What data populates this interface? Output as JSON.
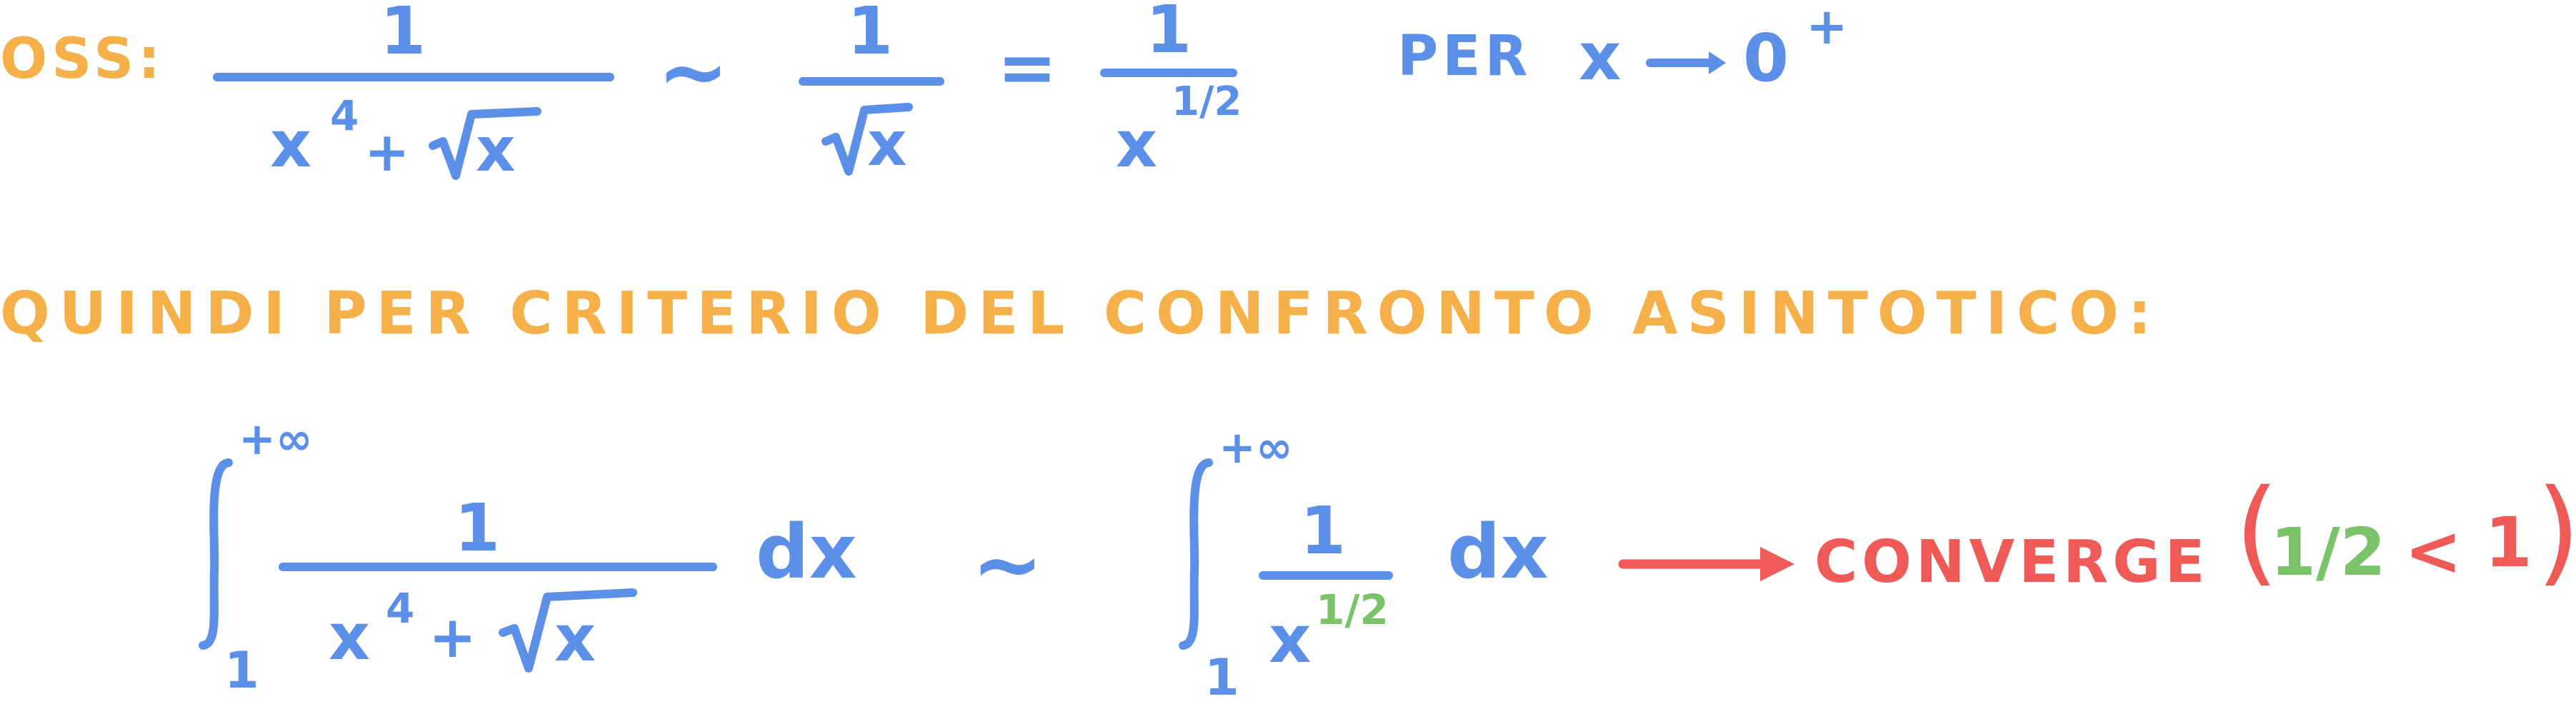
{
  "colors": {
    "blue": "#5b8fe8",
    "orange": "#f5b04a",
    "red": "#ef5a57",
    "green": "#7ac36a"
  },
  "line1": {
    "oss_label": "OSS:",
    "frac1_num": "1",
    "frac1_den_x": "x",
    "frac1_den_pow": "4",
    "frac1_den_plus": "+",
    "frac1_den_sqrt_x": "x",
    "sim": "~",
    "frac2_num": "1",
    "frac2_den_x": "x",
    "equals": "=",
    "frac3_num": "1",
    "frac3_den_x": "x",
    "frac3_den_pow": "1/2",
    "per": "PER",
    "x": "x",
    "zero": "0",
    "plus_sup": "+"
  },
  "line2": {
    "text": "QUINDI PER CRITERIO DEL CONFRONTO ASINTOTICO:"
  },
  "line3": {
    "int1_upper": "+∞",
    "int1_lower": "1",
    "frac_num": "1",
    "frac_den_x": "x",
    "frac_den_pow": "4",
    "frac_den_plus": "+",
    "frac_den_sqrt_x": "x",
    "dx1": "dx",
    "sim": "~",
    "int2_upper": "+∞",
    "int2_lower": "1",
    "frac2_num": "1",
    "frac2_den_x": "x",
    "frac2_den_pow": "1/2",
    "dx2": "dx",
    "converge": "CONVERGE",
    "paren_open": "(",
    "half": "1/2",
    "less_than": "<",
    "one": "1",
    "paren_close": ")"
  }
}
